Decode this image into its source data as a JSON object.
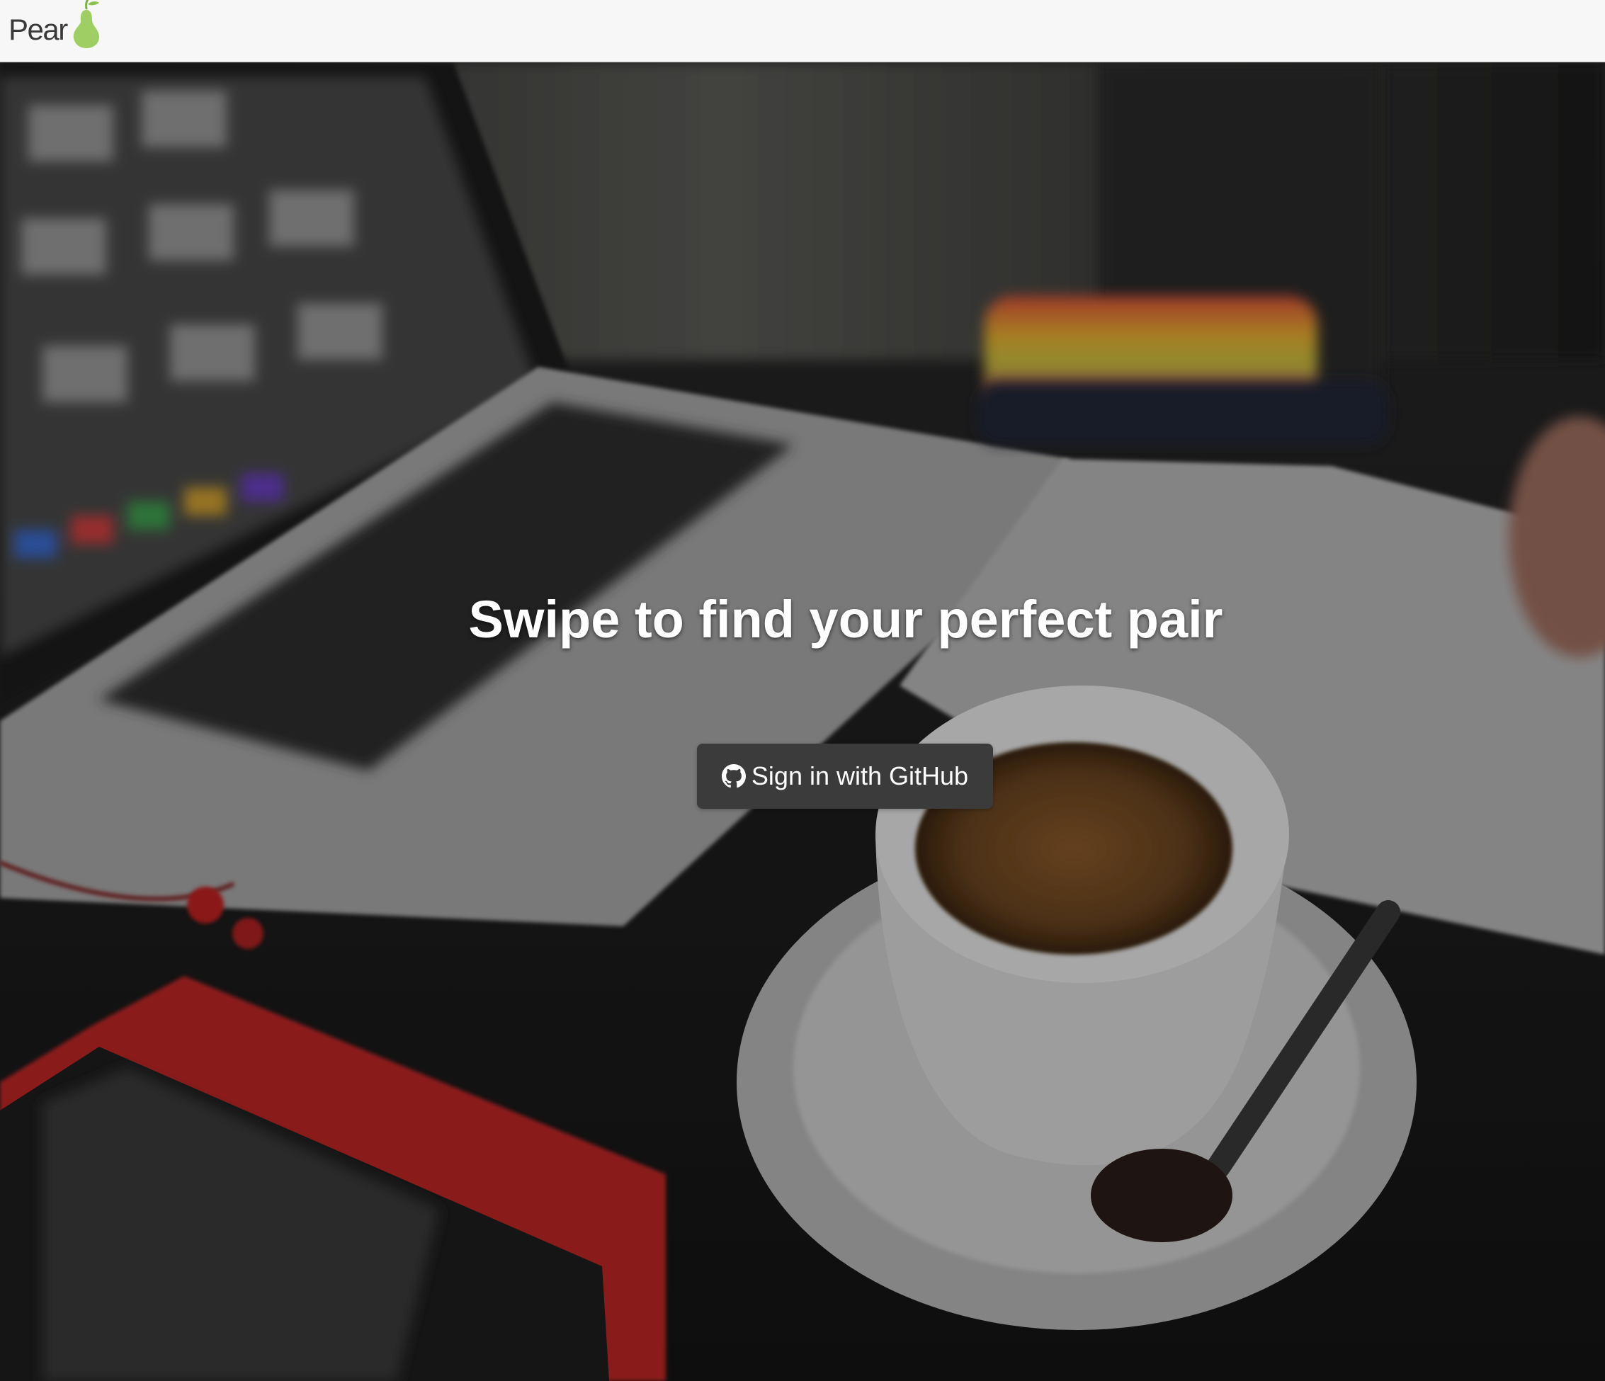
{
  "navbar": {
    "brand_text": "Pear",
    "logo_icon": "pear-icon",
    "background": "#f7f7f7"
  },
  "hero": {
    "headline": "Swipe to find your perfect pair",
    "background_image": "blurred desk with laptop, coffee cup, notebook and phone",
    "overlay_color": "#000000"
  },
  "auth": {
    "button_label": "Sign in with GitHub",
    "button_icon": "github-icon",
    "button_color": "#3b3b3b"
  },
  "colors": {
    "brand_green": "#8cc152",
    "text_dark": "#3a3a3a",
    "headline_text": "#ffffff"
  }
}
